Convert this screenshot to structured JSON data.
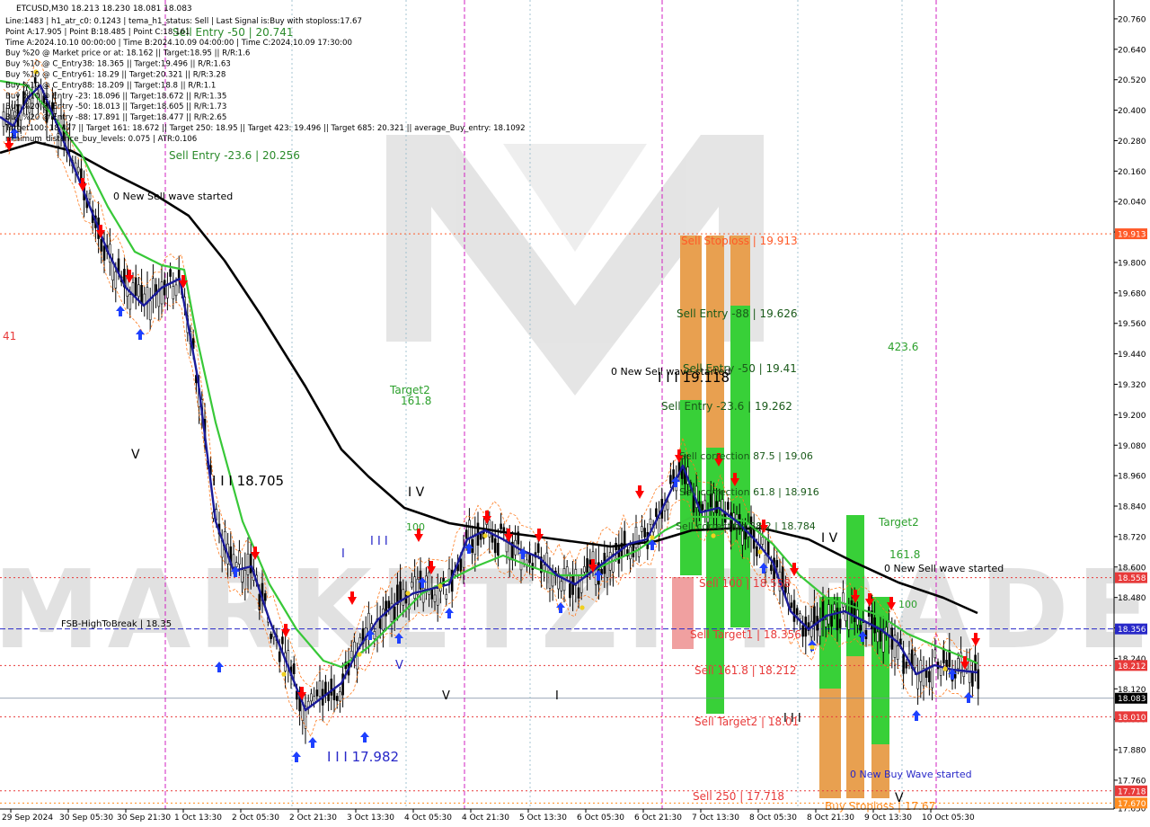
{
  "window": {
    "symbol_line": "ETCUSD,M30  18.213 18.230 18.081 18.083"
  },
  "info_lines": [
    "Line:1483 | h1_atr_c0: 0.1243 | tema_h1_status: Sell | Last Signal is:Buy with stoploss:17.67",
    "Point A:17.905 | Point B:18.485 | Point C:18.161",
    "Time A:2024.10.10 00:00:00 | Time B:2024.10.09 04:00:00 | Time C:2024.10.09 17:30:00",
    "Buy %20 @ Market price or at: 18.162 || Target:18.95 || R/R:1.6",
    "Buy %10 @ C_Entry38: 18.365 || Target:19.496 || R/R:1.63",
    "Buy %10 @ C_Entry61: 18.29 || Target:20.321 || R/R:3.28",
    "Buy %10 @ C_Entry88: 18.209 || Target:18.8 || R/R:1.1",
    "Buy %10 @ Entry -23: 18.096 || Target:18.672 || R/R:1.35",
    "Buy %20 @ Entry -50: 18.013 || Target:18.605 || R/R:1.73",
    "Buy %20 @ Entry -88: 17.891 || Target:18.477 || R/R:2.65",
    "Target100: 18.477 || Target 161: 18.672 || Target 250: 18.95 || Target 423: 19.496 || Target 685: 20.321 || average_Buy_entry: 18.1092",
    "minimum_distance_buy_levels: 0.075 | ATR:0.106"
  ],
  "chart_data": {
    "type": "candlestick",
    "symbol": "ETCUSD",
    "timeframe": "M30",
    "ylim": [
      17.65,
      20.82
    ],
    "y_ticks": [
      "20.760",
      "20.640",
      "20.520",
      "20.400",
      "20.280",
      "20.160",
      "20.040",
      "19.920",
      "19.800",
      "19.680",
      "19.560",
      "19.440",
      "19.320",
      "19.200",
      "19.080",
      "18.960",
      "18.840",
      "18.720",
      "18.600",
      "18.480",
      "18.360",
      "18.240",
      "18.120",
      "18.000",
      "17.880",
      "17.760",
      "17.650"
    ],
    "x_labels": [
      "29 Sep 2024",
      "30 Sep 05:30",
      "30 Sep 21:30",
      "1 Oct 13:30",
      "2 Oct 05:30",
      "2 Oct 21:30",
      "3 Oct 13:30",
      "4 Oct 05:30",
      "4 Oct 21:30",
      "5 Oct 13:30",
      "6 Oct 05:30",
      "6 Oct 21:30",
      "7 Oct 13:30",
      "8 Oct 05:30",
      "8 Oct 21:30",
      "9 Oct 13:30",
      "10 Oct 05:30"
    ],
    "price_tags": [
      {
        "value": "19.913",
        "color": "#ff5a28"
      },
      {
        "value": "18.558",
        "color": "#e83a3a"
      },
      {
        "value": "18.356",
        "color": "#2828c8"
      },
      {
        "value": "18.212",
        "color": "#e83a3a"
      },
      {
        "value": "18.083",
        "color": "#000000"
      },
      {
        "value": "18.010",
        "color": "#e83a3a"
      },
      {
        "value": "17.718",
        "color": "#e83a3a"
      },
      {
        "value": "17.670",
        "color": "#ff8c1e"
      }
    ],
    "hlines": [
      {
        "value": 19.913,
        "color": "#ff5a28",
        "style": "dotted"
      },
      {
        "value": 18.558,
        "color": "#e83a3a",
        "style": "dotted"
      },
      {
        "value": 18.356,
        "color": "#2828c8",
        "style": "dashed"
      },
      {
        "value": 18.212,
        "color": "#e83a3a",
        "style": "dotted"
      },
      {
        "value": 18.083,
        "color": "#7a8aa0",
        "style": "solid"
      },
      {
        "value": 18.01,
        "color": "#e83a3a",
        "style": "dotted"
      },
      {
        "value": 17.718,
        "color": "#e83a3a",
        "style": "dotted"
      },
      {
        "value": 17.67,
        "color": "#ff8c1e",
        "style": "dotted"
      }
    ],
    "annotations": [
      {
        "text": "Sell Entry -50 | 20.741",
        "color": "#2a8a2a",
        "x": 192,
        "y": 40,
        "size": 12
      },
      {
        "text": "Sell Entry -23.6 | 20.256",
        "color": "#2a8a2a",
        "x": 188,
        "y": 177,
        "size": 12
      },
      {
        "text": "0 New Sell wave started",
        "color": "#000000",
        "x": 126,
        "y": 222,
        "size": 11
      },
      {
        "text": "Target2",
        "color": "#2ca02c",
        "x": 434,
        "y": 438,
        "size": 12
      },
      {
        "text": "161.8",
        "color": "#2ca02c",
        "x": 446,
        "y": 450,
        "size": 12
      },
      {
        "text": "V",
        "color": "#000000",
        "x": 146,
        "y": 510,
        "size": 14
      },
      {
        "text": "I I I 18.705",
        "color": "#000000",
        "x": 236,
        "y": 540,
        "size": 15
      },
      {
        "text": "I V",
        "color": "#000000",
        "x": 454,
        "y": 552,
        "size": 14
      },
      {
        "text": "100",
        "color": "#2ca02c",
        "x": 452,
        "y": 590,
        "size": 11
      },
      {
        "text": "I",
        "color": "#2828c8",
        "x": 380,
        "y": 620,
        "size": 13
      },
      {
        "text": "I I I",
        "color": "#2828c8",
        "x": 412,
        "y": 606,
        "size": 13
      },
      {
        "text": "FSB-HighToBreak | 18.35",
        "color": "#000000",
        "x": 68,
        "y": 697,
        "size": 10
      },
      {
        "text": "V",
        "color": "#2828c8",
        "x": 440,
        "y": 744,
        "size": 13
      },
      {
        "text": "V",
        "color": "#000000",
        "x": 492,
        "y": 778,
        "size": 13
      },
      {
        "text": "I",
        "color": "#000000",
        "x": 618,
        "y": 778,
        "size": 13
      },
      {
        "text": "I I I 17.982",
        "color": "#2828c8",
        "x": 364,
        "y": 847,
        "size": 15
      },
      {
        "text": "Sell Stoploss | 19.913",
        "color": "#ff5a28",
        "x": 758,
        "y": 272,
        "size": 12
      },
      {
        "text": "Sell Entry -88 | 19.626",
        "color": "#1a5a1a",
        "x": 753,
        "y": 353,
        "size": 12
      },
      {
        "text": "0 New Sell wave started",
        "color": "#000000",
        "x": 680,
        "y": 417,
        "size": 11
      },
      {
        "text": "Sell Entry -50 | 19.41",
        "color": "#1a5a1a",
        "x": 760,
        "y": 414,
        "size": 12
      },
      {
        "text": "I I I 19.118",
        "color": "#000000",
        "x": 732,
        "y": 425,
        "size": 15
      },
      {
        "text": "Sell Entry -23.6 | 19.262",
        "color": "#1a5a1a",
        "x": 736,
        "y": 456,
        "size": 12
      },
      {
        "text": "Sell correction 87.5 | 19.06",
        "color": "#1a5a1a",
        "x": 756,
        "y": 511,
        "size": 11
      },
      {
        "text": "Sell correction 61.8 | 18.916",
        "color": "#1a5a1a",
        "x": 756,
        "y": 551,
        "size": 11
      },
      {
        "text": "Sell correction 38.2 | 18.784",
        "color": "#1a5a1a",
        "x": 752,
        "y": 589,
        "size": 11
      },
      {
        "text": "Sell 100 | 18.558",
        "color": "#e83a3a",
        "x": 778,
        "y": 653,
        "size": 12
      },
      {
        "text": "Sell Target1 | 18.356",
        "color": "#e83a3a",
        "x": 768,
        "y": 710,
        "size": 12
      },
      {
        "text": "Sell 161.8 | 18.212",
        "color": "#e83a3a",
        "x": 773,
        "y": 750,
        "size": 12
      },
      {
        "text": "Sell Target2 | 18.01",
        "color": "#e83a3a",
        "x": 773,
        "y": 807,
        "size": 12
      },
      {
        "text": "Sell 250 | 17.718",
        "color": "#e83a3a",
        "x": 771,
        "y": 890,
        "size": 12
      },
      {
        "text": "Buy Stoploss | 17.67",
        "color": "#ff8c1e",
        "x": 918,
        "y": 901,
        "size": 12
      },
      {
        "text": "423.6",
        "color": "#2ca02c",
        "x": 988,
        "y": 390,
        "size": 12
      },
      {
        "text": "Target2",
        "color": "#2ca02c",
        "x": 978,
        "y": 585,
        "size": 12
      },
      {
        "text": "161.8",
        "color": "#2ca02c",
        "x": 990,
        "y": 621,
        "size": 12
      },
      {
        "text": "I V",
        "color": "#000000",
        "x": 914,
        "y": 603,
        "size": 14
      },
      {
        "text": "0 New Sell wave started",
        "color": "#000000",
        "x": 984,
        "y": 636,
        "size": 11
      },
      {
        "text": "100",
        "color": "#2ca02c",
        "x": 1000,
        "y": 676,
        "size": 11
      },
      {
        "text": "I I I",
        "color": "#000000",
        "x": 872,
        "y": 803,
        "size": 13
      },
      {
        "text": "0 New Buy Wave started",
        "color": "#2828c8",
        "x": 946,
        "y": 865,
        "size": 11
      },
      {
        "text": "V",
        "color": "#000000",
        "x": 996,
        "y": 892,
        "size": 14
      },
      {
        "text": "41",
        "color": "#e83a3a",
        "x": 3,
        "y": 378,
        "size": 12
      }
    ],
    "zones": [
      {
        "name": "sell-stoploss-zone-1",
        "color": "#e8a050",
        "x0": 757,
        "x1": 781,
        "y_top": 262,
        "y_bottom": 640
      },
      {
        "name": "sell-stoploss-zone-2",
        "color": "#e8a050",
        "x0": 786,
        "x1": 806,
        "y_top": 262,
        "y_bottom": 640
      },
      {
        "name": "sell-stoploss-zone-3",
        "color": "#e8a050",
        "x0": 813,
        "x1": 835,
        "y_top": 262,
        "y_bottom": 640
      },
      {
        "name": "sell-entry-zone-1",
        "color": "#38d038",
        "x0": 757,
        "x1": 781,
        "y_top": 445,
        "y_bottom": 640
      },
      {
        "name": "sell-entry-zone-2",
        "color": "#38d038",
        "x0": 786,
        "x1": 806,
        "y_top": 498,
        "y_bottom": 794
      },
      {
        "name": "sell-entry-zone-3",
        "color": "#38d038",
        "x0": 813,
        "x1": 835,
        "y_top": 340,
        "y_bottom": 698
      },
      {
        "name": "sell-100-zone",
        "color": "#f0a0a0",
        "x0": 748,
        "x1": 772,
        "y_top": 642,
        "y_bottom": 722
      },
      {
        "name": "buy-zone-orange-1",
        "color": "#e8a050",
        "x0": 912,
        "x1": 936,
        "y_top": 766,
        "y_bottom": 888
      },
      {
        "name": "buy-zone-orange-2",
        "color": "#e8a050",
        "x0": 942,
        "x1": 962,
        "y_top": 730,
        "y_bottom": 888
      },
      {
        "name": "buy-zone-orange-3",
        "color": "#e8a050",
        "x0": 970,
        "x1": 990,
        "y_top": 828,
        "y_bottom": 888
      },
      {
        "name": "buy-zone-green-1",
        "color": "#38d038",
        "x0": 912,
        "x1": 936,
        "y_top": 664,
        "y_bottom": 766
      },
      {
        "name": "buy-zone-green-2",
        "color": "#38d038",
        "x0": 942,
        "x1": 962,
        "y_top": 573,
        "y_bottom": 730
      },
      {
        "name": "buy-zone-green-3",
        "color": "#38d038",
        "x0": 970,
        "x1": 990,
        "y_top": 664,
        "y_bottom": 828
      }
    ],
    "series": [
      {
        "name": "ma-black",
        "color": "#000000",
        "width": 2.6,
        "points": [
          [
            0,
            170
          ],
          [
            40,
            158
          ],
          [
            80,
            168
          ],
          [
            120,
            190
          ],
          [
            170,
            215
          ],
          [
            210,
            240
          ],
          [
            250,
            290
          ],
          [
            290,
            350
          ],
          [
            340,
            430
          ],
          [
            380,
            500
          ],
          [
            410,
            530
          ],
          [
            450,
            565
          ],
          [
            500,
            582
          ],
          [
            560,
            592
          ],
          [
            620,
            600
          ],
          [
            680,
            608
          ],
          [
            730,
            602
          ],
          [
            770,
            590
          ],
          [
            810,
            588
          ],
          [
            850,
            588
          ],
          [
            900,
            600
          ],
          [
            950,
            625
          ],
          [
            1000,
            648
          ],
          [
            1050,
            665
          ],
          [
            1088,
            682
          ]
        ]
      },
      {
        "name": "ma-green",
        "color": "#38c838",
        "width": 2.2,
        "points": [
          [
            0,
            90
          ],
          [
            30,
            95
          ],
          [
            60,
            130
          ],
          [
            90,
            170
          ],
          [
            120,
            230
          ],
          [
            150,
            280
          ],
          [
            180,
            295
          ],
          [
            205,
            300
          ],
          [
            220,
            380
          ],
          [
            240,
            470
          ],
          [
            270,
            580
          ],
          [
            300,
            650
          ],
          [
            330,
            700
          ],
          [
            360,
            735
          ],
          [
            380,
            742
          ],
          [
            410,
            720
          ],
          [
            440,
            690
          ],
          [
            470,
            660
          ],
          [
            500,
            645
          ],
          [
            530,
            630
          ],
          [
            560,
            618
          ],
          [
            590,
            630
          ],
          [
            620,
            640
          ],
          [
            650,
            640
          ],
          [
            680,
            625
          ],
          [
            710,
            612
          ],
          [
            740,
            590
          ],
          [
            770,
            575
          ],
          [
            800,
            575
          ],
          [
            830,
            580
          ],
          [
            860,
            605
          ],
          [
            890,
            640
          ],
          [
            920,
            665
          ],
          [
            950,
            675
          ],
          [
            980,
            685
          ],
          [
            1010,
            705
          ],
          [
            1040,
            718
          ],
          [
            1070,
            730
          ],
          [
            1088,
            738
          ]
        ]
      },
      {
        "name": "tema-blue",
        "color": "#1a1a9a",
        "width": 2.4,
        "points": [
          [
            0,
            130
          ],
          [
            15,
            140
          ],
          [
            30,
            110
          ],
          [
            45,
            95
          ],
          [
            60,
            130
          ],
          [
            80,
            180
          ],
          [
            100,
            230
          ],
          [
            120,
            280
          ],
          [
            140,
            320
          ],
          [
            160,
            340
          ],
          [
            180,
            320
          ],
          [
            200,
            310
          ],
          [
            220,
            420
          ],
          [
            240,
            580
          ],
          [
            260,
            635
          ],
          [
            280,
            630
          ],
          [
            300,
            690
          ],
          [
            320,
            740
          ],
          [
            340,
            790
          ],
          [
            360,
            775
          ],
          [
            380,
            760
          ],
          [
            400,
            720
          ],
          [
            420,
            690
          ],
          [
            440,
            672
          ],
          [
            460,
            660
          ],
          [
            480,
            655
          ],
          [
            500,
            650
          ],
          [
            520,
            600
          ],
          [
            540,
            590
          ],
          [
            560,
            600
          ],
          [
            580,
            612
          ],
          [
            600,
            620
          ],
          [
            620,
            640
          ],
          [
            640,
            650
          ],
          [
            660,
            635
          ],
          [
            680,
            620
          ],
          [
            700,
            605
          ],
          [
            720,
            600
          ],
          [
            740,
            560
          ],
          [
            760,
            518
          ],
          [
            780,
            570
          ],
          [
            800,
            565
          ],
          [
            820,
            580
          ],
          [
            840,
            600
          ],
          [
            860,
            625
          ],
          [
            880,
            680
          ],
          [
            900,
            700
          ],
          [
            920,
            685
          ],
          [
            940,
            680
          ],
          [
            960,
            690
          ],
          [
            980,
            700
          ],
          [
            1000,
            715
          ],
          [
            1020,
            750
          ],
          [
            1040,
            740
          ],
          [
            1060,
            745
          ],
          [
            1088,
            748
          ]
        ]
      }
    ],
    "vlines_magenta": [
      184,
      517,
      737,
      1042
    ],
    "vlines_dotted": [
      325,
      452,
      590,
      888,
      1004
    ],
    "tag_area_x": 1240
  }
}
